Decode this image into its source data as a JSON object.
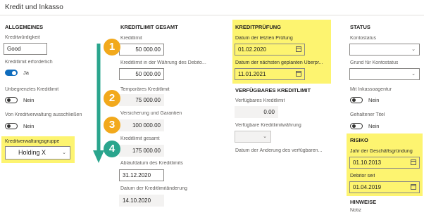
{
  "title": "Kredit und Inkasso",
  "allgemeines": {
    "header": "ALLGEMEINES",
    "kreditwuerdigkeit_label": "Kreditwürdigkeit",
    "kreditwuerdigkeit_value": "Good",
    "kreditlimit_erforderlich_label": "Kreditlimit erforderlich",
    "kreditlimit_erforderlich_value": "Ja",
    "unbegrenztes_label": "Unbegrenztes Kreditlimit",
    "unbegrenztes_value": "Nein",
    "ausschliessen_label": "Von Kreditverwaltung ausschließen",
    "ausschliessen_value": "Nein",
    "gruppe_label": "Kreditverwaltungsgruppe",
    "gruppe_value": "Holding X"
  },
  "kreditlimit_gesamt": {
    "header": "KREDITLIMIT GESAMT",
    "kreditlimit_label": "Kreditlimit",
    "kreditlimit_value": "50 000.00",
    "waehrung_label": "Kreditlimit in der Währung des Debito...",
    "waehrung_value": "50 000.00",
    "temporaer_label": "Temporäres Kreditlimit",
    "temporaer_value": "75 000.00",
    "versicherung_label": "Versicherung und Garantien",
    "versicherung_value": "100 000.00",
    "gesamt_label": "Kreditlimit gesamt",
    "gesamt_value": "175 000.00",
    "ablauf_label": "Ablaufdatum des Kreditlimits",
    "ablauf_value": "31.12.2020",
    "aenderung_label": "Datum der Kreditlimitänderung",
    "aenderung_value": "14.10.2020"
  },
  "kreditpruefung": {
    "header": "KREDITPRÜFUNG",
    "letzte_label": "Datum der letzten Prüfung",
    "letzte_value": "01.02.2020",
    "naechste_label": "Datum der nächsten geplanten Überpr...",
    "naechste_value": "11.01.2021"
  },
  "verfuegbar": {
    "header": "VERFÜGBARES KREDITLIMIT",
    "limit_label": "Verfügbares Kreditlimit",
    "limit_value": "0.00",
    "waehrung_label": "Verfügbare Kreditlimitwährung",
    "aenderung_label": "Datum der Änderung des verfügbaren..."
  },
  "status": {
    "header": "STATUS",
    "kontostatus_label": "Kontostatus",
    "grund_label": "Grund für Kontostatus",
    "inkasso_label": "Mit Inkassoagentur",
    "inkasso_value": "Nein",
    "titel_label": "Gehaltener Titel",
    "titel_value": "Nein"
  },
  "risiko": {
    "header": "RISIKO",
    "gruendung_label": "Jahr der Geschäftsgründung",
    "gruendung_value": "01.10.2013",
    "debitor_label": "Debitor seit",
    "debitor_value": "01.04.2019"
  },
  "hinweise": {
    "header": "HINWEISE",
    "notiz_label": "Notiz"
  },
  "callouts": [
    "1",
    "2",
    "3",
    "4"
  ],
  "colors": {
    "highlight": "#fdf470",
    "callout_orange": "#f2a91c",
    "callout_teal": "#2aa58d",
    "toggle_on": "#0f6cbd"
  }
}
